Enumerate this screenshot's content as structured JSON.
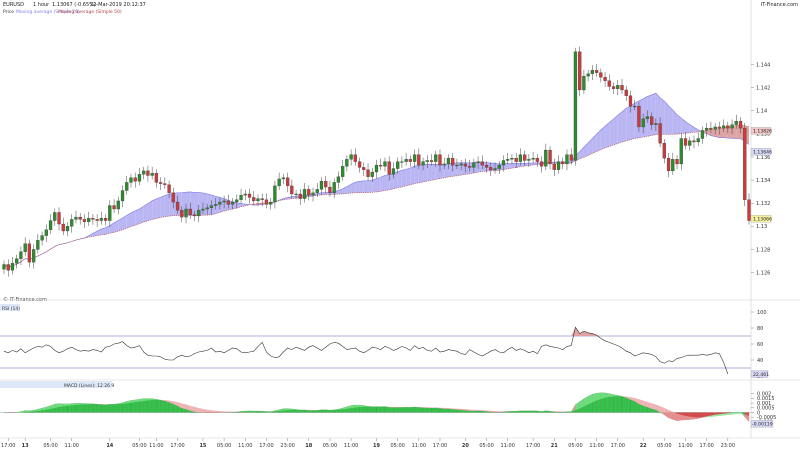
{
  "header": {
    "symbol": "EURUSD",
    "timeframe": "1 hour",
    "last_quote": "1.13067 (-0.65%)",
    "datetime": "22-Mar-2019 20:12:37",
    "brand": "IT-Finance.com"
  },
  "legend_price": {
    "price": "Price",
    "ma_fast": "Moving average (Simple 20)",
    "ma_slow": "Moving average (Simple 50)"
  },
  "watermark": "© IT-Finance.com",
  "colors": {
    "up_candle": "#2e8b2e",
    "down_candle": "#cc3b3b",
    "cloud_bull": "#b9b6f3",
    "cloud_bear": "#e0a3a3",
    "ma_fast": "#7f7ce0",
    "ma_slow": "#b34040",
    "rsi_line": "#333333",
    "rsi_levels": "#5b5bb8",
    "macd_pos": "#35c24a",
    "macd_neg": "#d94a4a",
    "last_price_tag": "#f5f0a0"
  },
  "chart_data": [
    {
      "type": "candlestick",
      "title": "EURUSD 1 hour",
      "ylim": [
        1.1238,
        1.1482
      ],
      "y_ticks": [
        "1.144",
        "1.142",
        "1.14",
        "1.138",
        "1.136",
        "1.134",
        "1.132",
        "1.13",
        "1.128",
        "1.126"
      ],
      "y_tick_values": [
        1.144,
        1.142,
        1.14,
        1.138,
        1.136,
        1.134,
        1.132,
        1.13,
        1.128,
        1.126
      ],
      "price_tags": [
        {
          "label": "1.13826",
          "value": 1.13826
        },
        {
          "label": "1.13646",
          "value": 1.13646
        },
        {
          "label": "1.13066",
          "value": 1.13066
        }
      ],
      "x_ticks": [
        "17:00",
        "13",
        "05:00",
        "11:00",
        "14",
        "05:00",
        "11:00",
        "17:00",
        "15",
        "05:00",
        "11:00",
        "17:00",
        "23:00",
        "18",
        "05:00",
        "11:00",
        "19",
        "05:00",
        "11:00",
        "17:00",
        "20",
        "05:00",
        "11:00",
        "17:00",
        "21",
        "05:00",
        "11:00",
        "17:00",
        "22",
        "05:00",
        "11:00",
        "17:00",
        "23:00"
      ],
      "x_tick_index": [
        1,
        5,
        11,
        16,
        25,
        32,
        36,
        41,
        47,
        52,
        57,
        62,
        67,
        72,
        77,
        82,
        88,
        93,
        98,
        103,
        109,
        114,
        119,
        125,
        130,
        135,
        140,
        145,
        151,
        156,
        161,
        166,
        171
      ],
      "x_tick_bold": [
        false,
        true,
        false,
        false,
        true,
        false,
        false,
        false,
        true,
        false,
        false,
        false,
        false,
        true,
        false,
        false,
        true,
        false,
        false,
        false,
        true,
        false,
        false,
        false,
        true,
        false,
        false,
        false,
        true,
        false,
        false,
        false,
        false
      ],
      "close": [
        1.1267,
        1.1262,
        1.1268,
        1.1272,
        1.1278,
        1.1285,
        1.1269,
        1.128,
        1.1288,
        1.1292,
        1.1297,
        1.1305,
        1.1312,
        1.1302,
        1.1296,
        1.13,
        1.1306,
        1.1308,
        1.1306,
        1.1304,
        1.1307,
        1.1306,
        1.1305,
        1.1307,
        1.1305,
        1.1318,
        1.1315,
        1.1322,
        1.1331,
        1.1338,
        1.1342,
        1.1339,
        1.1345,
        1.1348,
        1.1344,
        1.1346,
        1.1338,
        1.1337,
        1.1336,
        1.1329,
        1.1321,
        1.1314,
        1.1308,
        1.1315,
        1.131,
        1.1309,
        1.1314,
        1.1315,
        1.1316,
        1.1318,
        1.1319,
        1.1321,
        1.1322,
        1.1319,
        1.1321,
        1.1323,
        1.1327,
        1.1328,
        1.1325,
        1.1322,
        1.1324,
        1.1323,
        1.1319,
        1.1321,
        1.1335,
        1.1341,
        1.1342,
        1.1335,
        1.1328,
        1.1328,
        1.1324,
        1.1332,
        1.1327,
        1.1329,
        1.1332,
        1.1339,
        1.1334,
        1.1329,
        1.1338,
        1.1343,
        1.1352,
        1.1358,
        1.1362,
        1.1356,
        1.1351,
        1.1349,
        1.1343,
        1.1347,
        1.1353,
        1.1352,
        1.1356,
        1.1345,
        1.135,
        1.1356,
        1.1356,
        1.1358,
        1.1356,
        1.1362,
        1.1353,
        1.1356,
        1.1357,
        1.1356,
        1.1362,
        1.1353,
        1.1354,
        1.1359,
        1.1353,
        1.1353,
        1.1354,
        1.1352,
        1.1351,
        1.1355,
        1.1356,
        1.1353,
        1.1351,
        1.1349,
        1.135,
        1.1353,
        1.1357,
        1.1358,
        1.1359,
        1.1356,
        1.1362,
        1.1357,
        1.1358,
        1.1359,
        1.1356,
        1.1352,
        1.1366,
        1.1354,
        1.1349,
        1.1356,
        1.1354,
        1.1362,
        1.1357,
        1.1451,
        1.1418,
        1.143,
        1.1432,
        1.1435,
        1.1433,
        1.1429,
        1.1426,
        1.1421,
        1.1419,
        1.1422,
        1.1418,
        1.1413,
        1.1404,
        1.1404,
        1.1386,
        1.1393,
        1.1395,
        1.1388,
        1.1389,
        1.1372,
        1.1359,
        1.1348,
        1.1358,
        1.1354,
        1.1376,
        1.137,
        1.1374,
        1.1373,
        1.1376,
        1.1383,
        1.1385,
        1.1384,
        1.1386,
        1.1385,
        1.1387,
        1.1385,
        1.1388,
        1.1391,
        1.1385,
        1.1323,
        1.1305
      ],
      "volatility_note": "OHLC approximated from close with small wicks",
      "moving_averages": [
        {
          "name": "Moving average (Simple 20)"
        },
        {
          "name": "Moving average (Simple 50)"
        }
      ]
    },
    {
      "type": "line",
      "title": "RSI (14)",
      "ylim": [
        20,
        100
      ],
      "y_ticks": [
        "100",
        "80",
        "60",
        "40",
        "20"
      ],
      "y_tick_values": [
        100,
        80,
        60,
        40,
        20
      ],
      "levels": [
        70,
        30
      ],
      "last_tag": {
        "label": "22.461",
        "value": 22.461
      },
      "values": [
        51,
        49,
        52,
        50,
        54,
        49,
        52,
        55,
        57,
        56,
        59,
        57,
        52,
        49,
        51,
        54,
        56,
        53,
        51,
        52,
        51,
        53,
        52,
        50,
        56,
        57,
        60,
        61,
        63,
        58,
        55,
        56,
        58,
        50,
        46,
        45,
        45,
        44,
        41,
        40,
        40,
        44,
        46,
        44,
        45,
        48,
        50,
        51,
        52,
        55,
        50,
        51,
        49,
        52,
        55,
        54,
        50,
        49,
        50,
        51,
        57,
        62,
        50,
        45,
        43,
        44,
        50,
        55,
        53,
        56,
        54,
        52,
        56,
        58,
        55,
        52,
        56,
        60,
        62,
        61,
        57,
        53,
        54,
        55,
        51,
        49,
        52,
        56,
        55,
        53,
        57,
        55,
        52,
        54,
        57,
        55,
        52,
        58,
        54,
        56,
        52,
        51,
        55,
        50,
        51,
        53,
        52,
        51,
        48,
        47,
        53,
        50,
        47,
        45,
        48,
        51,
        53,
        50,
        49,
        53,
        56,
        52,
        54,
        52,
        49,
        51,
        48,
        57,
        59,
        57,
        56,
        55,
        53,
        57,
        58,
        81,
        73,
        76,
        74,
        73,
        71,
        67,
        64,
        62,
        60,
        58,
        55,
        51,
        49,
        45,
        47,
        49,
        48,
        47,
        44,
        38,
        36,
        39,
        38,
        42,
        43,
        45,
        46,
        46,
        46,
        47,
        46,
        47,
        49,
        48,
        37,
        22.461
      ]
    },
    {
      "type": "histogram",
      "title": "MACD (Lines)",
      "series": [
        {
          "name": "MACD (Lines): 12 26 9"
        }
      ],
      "ylim": [
        -0.0025,
        0.0025
      ],
      "y_ticks": [
        "0.002",
        "0.0015",
        "0.001",
        "0.0005",
        "0",
        "-0.0005",
        "-0.001"
      ],
      "y_tick_values": [
        0.002,
        0.0015,
        0.001,
        0.0005,
        0,
        -0.0005,
        -0.001
      ],
      "last_tag": {
        "label": "-0.00119",
        "value": -0.00119
      }
    }
  ]
}
